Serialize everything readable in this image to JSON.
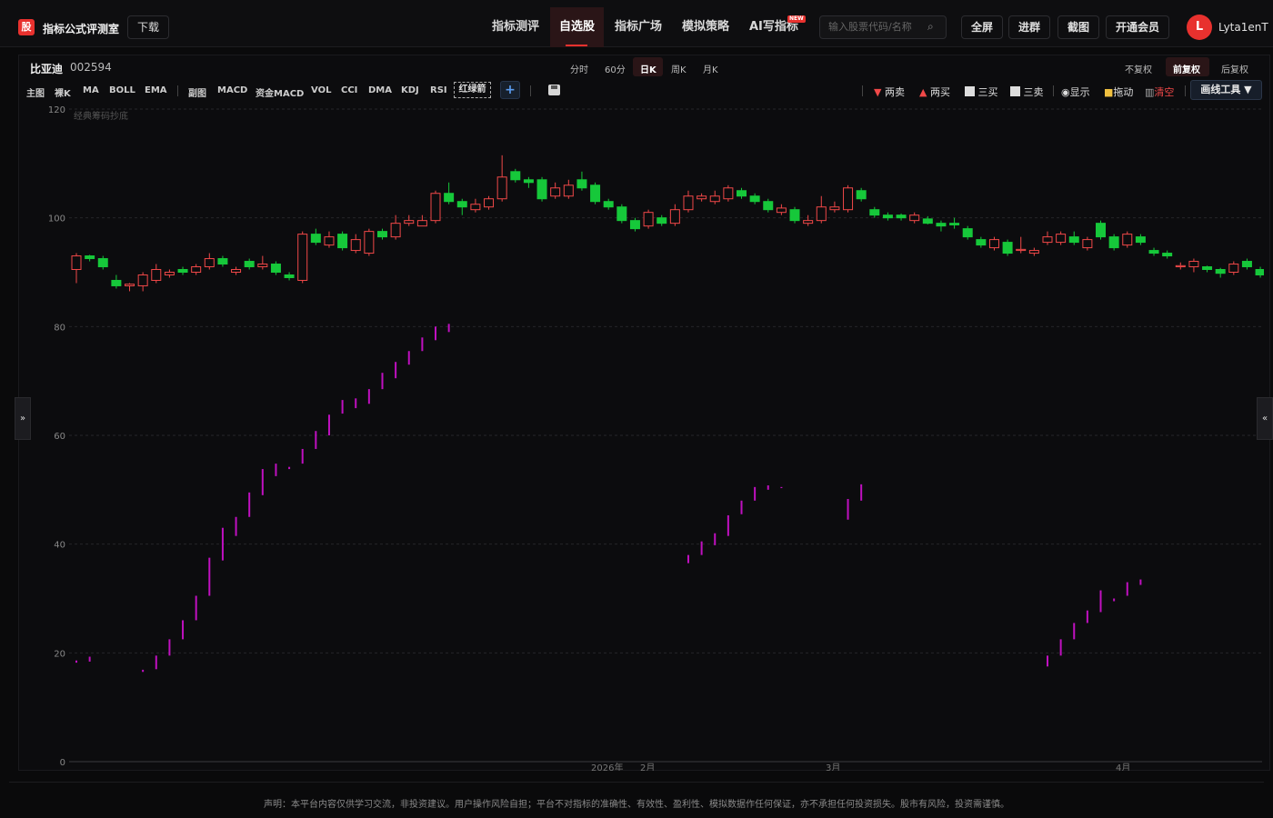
{
  "header": {
    "logo_char": "股",
    "app_title": "指标公式评测室",
    "download_label": "下载",
    "nav": [
      {
        "label": "指标测评"
      },
      {
        "label": "自选股",
        "active": true
      },
      {
        "label": "指标广场"
      },
      {
        "label": "模拟策略"
      },
      {
        "label": "AI写指标",
        "badge": "NEW"
      }
    ],
    "search_placeholder": "输入股票代码/名称",
    "buttons": [
      "全屏",
      "进群",
      "截图",
      "开通会员"
    ],
    "avatar_letter": "L",
    "username": "Lyta1enT"
  },
  "stock": {
    "name": "比亚迪",
    "code": "002594"
  },
  "periods": [
    "分时",
    "60分",
    "日K",
    "周K",
    "月K"
  ],
  "active_period": "日K",
  "adjust": [
    "不复权",
    "前复权",
    "后复权"
  ],
  "active_adjust": "前复权",
  "indicators": [
    "主图",
    "裸K",
    "MA",
    "BOLL",
    "EMA",
    "副图",
    "MACD",
    "资金MACD",
    "VOL",
    "CCI",
    "DMA",
    "KDJ",
    "RSI"
  ],
  "indicator_selected": "红绿箭",
  "marks": [
    "两卖",
    "两买",
    "三买",
    "三卖",
    "显示",
    "拖动",
    "清空"
  ],
  "draw_tools_label": "画线工具 ▼",
  "colors": {
    "up": "#f04848",
    "down": "#16c83a",
    "line": "#c010c0",
    "accent": "#e8312e"
  },
  "chart_data": {
    "type": "candlestick",
    "overlay_label": "经典筹码抄底",
    "ylim": [
      0,
      120
    ],
    "yticks": [
      0,
      20,
      40,
      60,
      80,
      100,
      120
    ],
    "x_labels": [
      "2026年",
      "2月",
      "3月",
      "4月"
    ],
    "candles": [
      {
        "o": 90.5,
        "c": 93.0,
        "h": 93.5,
        "l": 88.0
      },
      {
        "o": 93.0,
        "c": 92.5,
        "h": 93.2,
        "l": 92.0
      },
      {
        "o": 92.5,
        "c": 91.0,
        "h": 93.0,
        "l": 90.5
      },
      {
        "o": 88.5,
        "c": 87.5,
        "h": 89.5,
        "l": 87.0
      },
      {
        "o": 87.5,
        "c": 87.8,
        "h": 88.0,
        "l": 86.5
      },
      {
        "o": 87.5,
        "c": 89.5,
        "h": 90.0,
        "l": 86.5
      },
      {
        "o": 88.5,
        "c": 90.5,
        "h": 91.5,
        "l": 88.0
      },
      {
        "o": 89.5,
        "c": 90.0,
        "h": 90.5,
        "l": 89.0
      },
      {
        "o": 90.5,
        "c": 90.0,
        "h": 91.0,
        "l": 89.5
      },
      {
        "o": 90.0,
        "c": 91.0,
        "h": 91.5,
        "l": 89.5
      },
      {
        "o": 91.0,
        "c": 92.5,
        "h": 93.5,
        "l": 90.5
      },
      {
        "o": 92.5,
        "c": 91.5,
        "h": 93.0,
        "l": 91.0
      },
      {
        "o": 90.0,
        "c": 90.5,
        "h": 91.0,
        "l": 89.5
      },
      {
        "o": 92.0,
        "c": 91.0,
        "h": 92.5,
        "l": 90.5
      },
      {
        "o": 91.0,
        "c": 91.5,
        "h": 93.0,
        "l": 90.5
      },
      {
        "o": 91.5,
        "c": 90.0,
        "h": 92.0,
        "l": 89.5
      },
      {
        "o": 89.5,
        "c": 89.0,
        "h": 90.0,
        "l": 88.5
      },
      {
        "o": 88.5,
        "c": 97.0,
        "h": 97.5,
        "l": 88.0
      },
      {
        "o": 97.0,
        "c": 95.5,
        "h": 98.0,
        "l": 95.0
      },
      {
        "o": 95.0,
        "c": 96.5,
        "h": 97.5,
        "l": 94.5
      },
      {
        "o": 97.0,
        "c": 94.5,
        "h": 97.5,
        "l": 94.0
      },
      {
        "o": 94.0,
        "c": 96.0,
        "h": 97.0,
        "l": 93.5
      },
      {
        "o": 93.5,
        "c": 97.5,
        "h": 98.0,
        "l": 93.0
      },
      {
        "o": 97.5,
        "c": 96.5,
        "h": 98.0,
        "l": 96.0
      },
      {
        "o": 96.5,
        "c": 99.0,
        "h": 100.5,
        "l": 96.0
      },
      {
        "o": 99.0,
        "c": 99.5,
        "h": 100.5,
        "l": 98.5
      },
      {
        "o": 98.5,
        "c": 99.5,
        "h": 100.5,
        "l": 98.5
      },
      {
        "o": 99.5,
        "c": 104.5,
        "h": 105.0,
        "l": 99.0
      },
      {
        "o": 104.5,
        "c": 103.0,
        "h": 106.5,
        "l": 102.5
      },
      {
        "o": 103.0,
        "c": 102.0,
        "h": 103.5,
        "l": 100.5
      },
      {
        "o": 101.5,
        "c": 102.5,
        "h": 103.5,
        "l": 101.0
      },
      {
        "o": 102.0,
        "c": 103.5,
        "h": 104.0,
        "l": 101.5
      },
      {
        "o": 103.5,
        "c": 107.5,
        "h": 111.5,
        "l": 103.0
      },
      {
        "o": 108.5,
        "c": 107.0,
        "h": 109.0,
        "l": 106.5
      },
      {
        "o": 107.0,
        "c": 106.5,
        "h": 107.5,
        "l": 105.5
      },
      {
        "o": 107.0,
        "c": 103.5,
        "h": 107.5,
        "l": 103.0
      },
      {
        "o": 104.0,
        "c": 105.5,
        "h": 106.5,
        "l": 103.5
      },
      {
        "o": 104.0,
        "c": 106.0,
        "h": 107.0,
        "l": 103.5
      },
      {
        "o": 107.0,
        "c": 105.5,
        "h": 108.5,
        "l": 105.0
      },
      {
        "o": 106.0,
        "c": 103.0,
        "h": 106.5,
        "l": 102.5
      },
      {
        "o": 103.0,
        "c": 102.0,
        "h": 103.5,
        "l": 101.5
      },
      {
        "o": 102.0,
        "c": 99.5,
        "h": 102.5,
        "l": 99.0
      },
      {
        "o": 99.5,
        "c": 98.0,
        "h": 100.0,
        "l": 97.5
      },
      {
        "o": 98.5,
        "c": 101.0,
        "h": 101.5,
        "l": 98.0
      },
      {
        "o": 100.0,
        "c": 99.0,
        "h": 100.5,
        "l": 98.5
      },
      {
        "o": 99.0,
        "c": 101.5,
        "h": 102.5,
        "l": 98.5
      },
      {
        "o": 101.5,
        "c": 104.0,
        "h": 105.0,
        "l": 101.0
      },
      {
        "o": 103.5,
        "c": 104.0,
        "h": 104.5,
        "l": 103.0
      },
      {
        "o": 103.0,
        "c": 104.0,
        "h": 105.0,
        "l": 102.5
      },
      {
        "o": 103.5,
        "c": 105.5,
        "h": 106.0,
        "l": 103.0
      },
      {
        "o": 105.0,
        "c": 104.0,
        "h": 105.5,
        "l": 103.5
      },
      {
        "o": 104.0,
        "c": 103.0,
        "h": 104.5,
        "l": 102.5
      },
      {
        "o": 103.0,
        "c": 101.5,
        "h": 103.5,
        "l": 101.0
      },
      {
        "o": 101.0,
        "c": 101.8,
        "h": 102.5,
        "l": 100.5
      },
      {
        "o": 101.5,
        "c": 99.5,
        "h": 102.0,
        "l": 99.0
      },
      {
        "o": 99.0,
        "c": 99.5,
        "h": 100.5,
        "l": 98.5
      },
      {
        "o": 99.5,
        "c": 102.0,
        "h": 104.0,
        "l": 99.0
      },
      {
        "o": 101.5,
        "c": 102.0,
        "h": 103.0,
        "l": 101.0
      },
      {
        "o": 101.5,
        "c": 105.5,
        "h": 106.0,
        "l": 101.0
      },
      {
        "o": 105.0,
        "c": 103.5,
        "h": 105.5,
        "l": 103.0
      },
      {
        "o": 101.5,
        "c": 100.5,
        "h": 102.0,
        "l": 100.0
      },
      {
        "o": 100.5,
        "c": 100.0,
        "h": 101.0,
        "l": 99.5
      },
      {
        "o": 100.5,
        "c": 100.0,
        "h": 100.8,
        "l": 99.5
      },
      {
        "o": 99.5,
        "c": 100.5,
        "h": 101.0,
        "l": 99.0
      },
      {
        "o": 99.8,
        "c": 99.0,
        "h": 100.3,
        "l": 98.8
      },
      {
        "o": 99.0,
        "c": 98.5,
        "h": 99.5,
        "l": 97.5
      },
      {
        "o": 99.0,
        "c": 98.7,
        "h": 100.0,
        "l": 98.0
      },
      {
        "o": 98.0,
        "c": 96.5,
        "h": 98.5,
        "l": 96.0
      },
      {
        "o": 96.0,
        "c": 95.0,
        "h": 96.5,
        "l": 94.5
      },
      {
        "o": 94.5,
        "c": 96.0,
        "h": 96.5,
        "l": 94.0
      },
      {
        "o": 95.5,
        "c": 93.5,
        "h": 96.0,
        "l": 93.0
      },
      {
        "o": 94.0,
        "c": 94.2,
        "h": 96.5,
        "l": 93.5
      },
      {
        "o": 93.5,
        "c": 94.0,
        "h": 94.5,
        "l": 93.0
      },
      {
        "o": 95.5,
        "c": 96.5,
        "h": 97.5,
        "l": 95.0
      },
      {
        "o": 95.5,
        "c": 97.0,
        "h": 97.5,
        "l": 95.0
      },
      {
        "o": 96.5,
        "c": 95.5,
        "h": 97.5,
        "l": 95.0
      },
      {
        "o": 94.5,
        "c": 96.0,
        "h": 96.5,
        "l": 94.0
      },
      {
        "o": 99.0,
        "c": 96.5,
        "h": 99.5,
        "l": 96.0
      },
      {
        "o": 96.5,
        "c": 94.5,
        "h": 97.0,
        "l": 94.0
      },
      {
        "o": 95.0,
        "c": 97.0,
        "h": 97.5,
        "l": 94.5
      },
      {
        "o": 96.5,
        "c": 95.5,
        "h": 97.0,
        "l": 95.0
      },
      {
        "o": 94.0,
        "c": 93.5,
        "h": 94.5,
        "l": 93.0
      },
      {
        "o": 93.5,
        "c": 93.0,
        "h": 94.0,
        "l": 92.5
      },
      {
        "o": 91.0,
        "c": 91.2,
        "h": 91.8,
        "l": 90.5
      },
      {
        "o": 91.0,
        "c": 92.0,
        "h": 92.5,
        "l": 90.0
      },
      {
        "o": 91.0,
        "c": 90.5,
        "h": 91.2,
        "l": 90.0
      },
      {
        "o": 90.5,
        "c": 89.8,
        "h": 90.8,
        "l": 89.0
      },
      {
        "o": 90.0,
        "c": 91.5,
        "h": 92.0,
        "l": 89.5
      },
      {
        "o": 92.0,
        "c": 91.0,
        "h": 92.5,
        "l": 90.5
      },
      {
        "o": 90.5,
        "c": 89.5,
        "h": 91.0,
        "l": 89.0
      }
    ],
    "line_segments": [
      {
        "i": 0,
        "lo": 18.2,
        "hi": 18.6
      },
      {
        "i": 1,
        "lo": 18.4,
        "hi": 19.3
      },
      {
        "i": 5,
        "lo": 16.5,
        "hi": 16.9
      },
      {
        "i": 6,
        "lo": 17.0,
        "hi": 19.5
      },
      {
        "i": 7,
        "lo": 19.5,
        "hi": 22.5
      },
      {
        "i": 8,
        "lo": 22.5,
        "hi": 26.0
      },
      {
        "i": 9,
        "lo": 26.0,
        "hi": 30.5
      },
      {
        "i": 10,
        "lo": 30.5,
        "hi": 37.5
      },
      {
        "i": 11,
        "lo": 37.0,
        "hi": 43.0
      },
      {
        "i": 12,
        "lo": 41.5,
        "hi": 45.0
      },
      {
        "i": 13,
        "lo": 45.0,
        "hi": 49.5
      },
      {
        "i": 14,
        "lo": 49.0,
        "hi": 53.8
      },
      {
        "i": 15,
        "lo": 52.5,
        "hi": 54.8
      },
      {
        "i": 16,
        "lo": 53.8,
        "hi": 54.2
      },
      {
        "i": 17,
        "lo": 54.8,
        "hi": 57.5
      },
      {
        "i": 18,
        "lo": 57.5,
        "hi": 60.8
      },
      {
        "i": 19,
        "lo": 60.0,
        "hi": 63.8
      },
      {
        "i": 20,
        "lo": 64.0,
        "hi": 66.5
      },
      {
        "i": 21,
        "lo": 65.0,
        "hi": 66.8
      },
      {
        "i": 22,
        "lo": 65.8,
        "hi": 68.5
      },
      {
        "i": 23,
        "lo": 68.5,
        "hi": 71.5
      },
      {
        "i": 24,
        "lo": 70.5,
        "hi": 73.5
      },
      {
        "i": 25,
        "lo": 73.0,
        "hi": 75.5
      },
      {
        "i": 26,
        "lo": 75.5,
        "hi": 78.0
      },
      {
        "i": 27,
        "lo": 77.5,
        "hi": 80.0
      },
      {
        "i": 28,
        "lo": 79.0,
        "hi": 80.5
      },
      {
        "i": 46,
        "lo": 36.5,
        "hi": 38.0
      },
      {
        "i": 47,
        "lo": 38.0,
        "hi": 40.5
      },
      {
        "i": 48,
        "lo": 39.8,
        "hi": 42.0
      },
      {
        "i": 49,
        "lo": 41.5,
        "hi": 45.3
      },
      {
        "i": 50,
        "lo": 45.5,
        "hi": 48.0
      },
      {
        "i": 51,
        "lo": 48.0,
        "hi": 50.5
      },
      {
        "i": 52,
        "lo": 50.0,
        "hi": 50.8
      },
      {
        "i": 53,
        "lo": 50.3,
        "hi": 50.5
      },
      {
        "i": 58,
        "lo": 44.5,
        "hi": 48.3
      },
      {
        "i": 59,
        "lo": 48.0,
        "hi": 51.0
      },
      {
        "i": 73,
        "lo": 17.5,
        "hi": 19.5
      },
      {
        "i": 74,
        "lo": 19.5,
        "hi": 22.5
      },
      {
        "i": 75,
        "lo": 22.5,
        "hi": 25.5
      },
      {
        "i": 76,
        "lo": 25.5,
        "hi": 27.8
      },
      {
        "i": 77,
        "lo": 27.5,
        "hi": 31.5
      },
      {
        "i": 78,
        "lo": 29.5,
        "hi": 30.0
      },
      {
        "i": 79,
        "lo": 30.5,
        "hi": 33.0
      },
      {
        "i": 80,
        "lo": 32.5,
        "hi": 33.5
      }
    ]
  },
  "disclaimer": "声明：本平台内容仅供学习交流，非投资建议。用户操作风险自担；平台不对指标的准确性、有效性、盈利性、模拟数据作任何保证，亦不承担任何投资损失。股市有风险，投资需谨慎。"
}
